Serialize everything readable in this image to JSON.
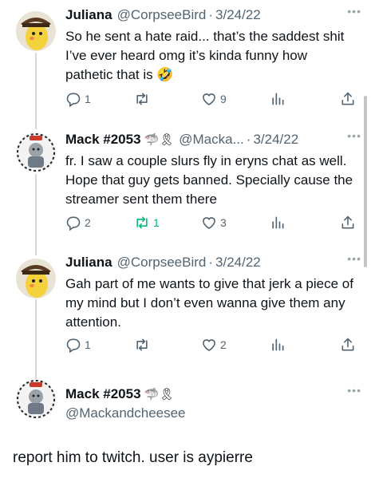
{
  "tweets": [
    {
      "name": "Juliana",
      "handle": "@CorpseeBird",
      "date": "3/24/22",
      "text": "So he sent a hate raid... that’s the saddest shit I’ve ever heard omg it’s kinda funny how pathetic that is 🤣",
      "replies": "1",
      "retweets": "",
      "likes": "9"
    },
    {
      "name": "Mack #2053",
      "badges": "🦈🎗",
      "handle": "@Macka...",
      "date": "3/24/22",
      "text": "fr. I saw a couple slurs fly in eryns chat as well. Hope that guy gets banned. Specially cause the streamer sent them there",
      "replies": "2",
      "retweets": "1",
      "likes": "3"
    },
    {
      "name": "Juliana",
      "handle": "@CorpseeBird",
      "date": "3/24/22",
      "text": "Gah part of me wants to give that jerk a piece of my mind but I don’t even wanna give them any attention.",
      "replies": "1",
      "retweets": "",
      "likes": "2"
    }
  ],
  "focused": {
    "name": "Mack #2053",
    "badges": "🦈🎗",
    "handle": "@Mackandcheesee",
    "text": "report him to twitch. user is aypierre"
  },
  "ui": {
    "dot": "·",
    "more": "•••"
  },
  "colors": {
    "accent": "#1d9bf0",
    "retweet_active": "#00ba7c",
    "muted": "#536471"
  },
  "icons": [
    "reply-icon",
    "retweet-icon",
    "like-icon",
    "views-icon",
    "share-icon",
    "more-icon"
  ]
}
